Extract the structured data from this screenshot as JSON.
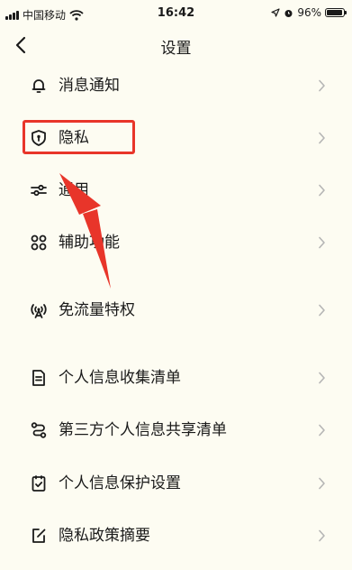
{
  "status_bar": {
    "carrier": "中国移动",
    "time": "16:42",
    "battery": "96%",
    "battery_level": 0.96
  },
  "nav": {
    "title": "设置"
  },
  "menu": [
    {
      "label": "消息通知",
      "icon": "bell-icon"
    },
    {
      "label": "隐私",
      "icon": "shield-lock-icon"
    },
    {
      "label": "通用",
      "icon": "sliders-icon"
    },
    {
      "label": "辅助功能",
      "icon": "grid-clover-icon"
    },
    {
      "label": "免流量特权",
      "icon": "broadcast-icon"
    },
    {
      "label": "个人信息收集清单",
      "icon": "document-list-icon"
    },
    {
      "label": "第三方个人信息共享清单",
      "icon": "share-link-icon"
    },
    {
      "label": "个人信息保护设置",
      "icon": "check-document-icon"
    },
    {
      "label": "隐私政策摘要",
      "icon": "edit-document-icon"
    }
  ],
  "colors": {
    "background": "#fdfcf2",
    "highlight": "#e8352a",
    "text": "#1a1a1a",
    "chevron": "#b5b5b5"
  }
}
